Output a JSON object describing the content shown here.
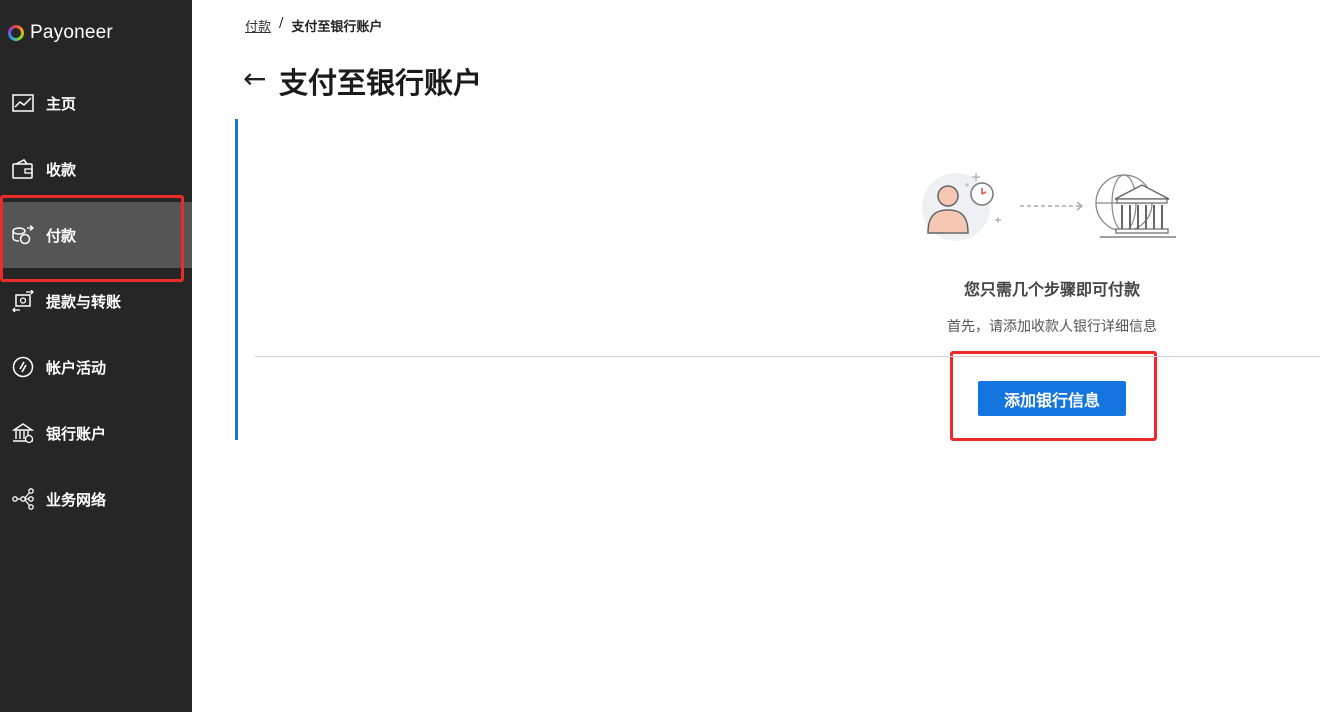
{
  "brand": {
    "name": "Payoneer"
  },
  "sidebar": {
    "items": [
      {
        "label": "主页",
        "icon": "chart-icon"
      },
      {
        "label": "收款",
        "icon": "wallet-icon"
      },
      {
        "label": "付款",
        "icon": "coins-send-icon",
        "active": true
      },
      {
        "label": "提款与转账",
        "icon": "transfer-icon"
      },
      {
        "label": "帐户活动",
        "icon": "activity-icon"
      },
      {
        "label": "银行账户",
        "icon": "bank-icon"
      },
      {
        "label": "业务网络",
        "icon": "network-icon"
      }
    ]
  },
  "breadcrumb": {
    "parent": "付款",
    "separator": "/",
    "current": "支付至银行账户"
  },
  "page": {
    "back_icon": "←",
    "title": "支付至银行账户"
  },
  "empty_state": {
    "heading": "您只需几个步骤即可付款",
    "subtext": "首先，请添加收款人银行详细信息",
    "button_label": "添加银行信息"
  },
  "colors": {
    "sidebar_bg": "#262626",
    "active_bg": "#555555",
    "primary": "#1475e1",
    "highlight": "#ee2b2b"
  }
}
